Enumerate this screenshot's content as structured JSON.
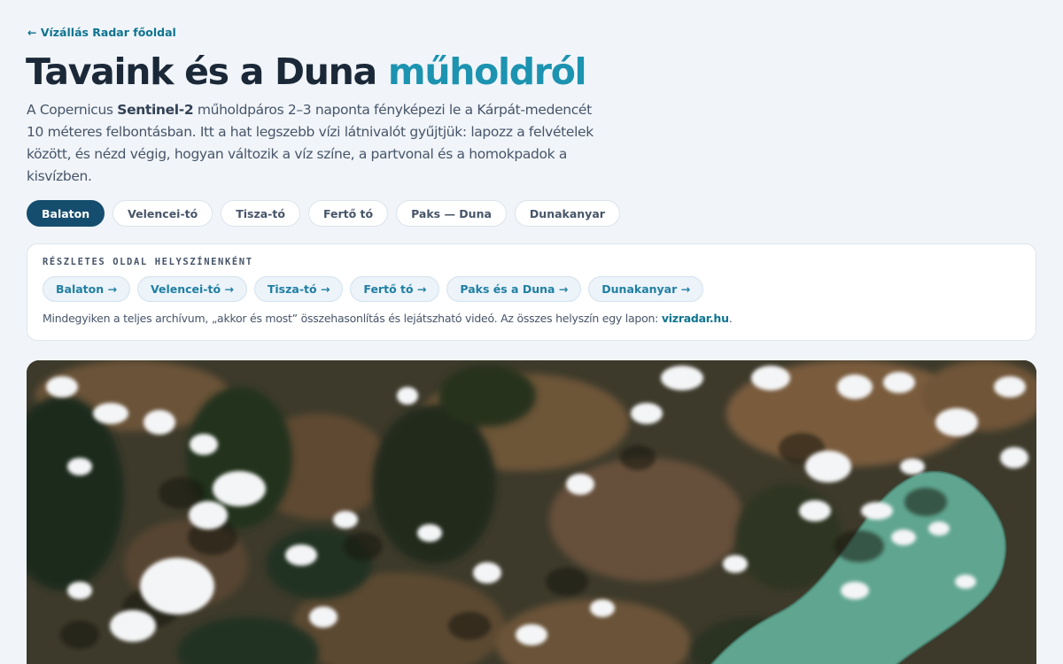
{
  "back_link": "← Vízállás Radar főoldal",
  "title": {
    "main": "Tavaink és a Duna ",
    "accent": "műholdról"
  },
  "intro": {
    "part1": "A Copernicus ",
    "bold": "Sentinel-2",
    "part2": " műholdpáros 2–3 naponta fényképezi le a Kárpát-medencét 10 méteres felbontásban. Itt a hat legszebb vízi látnivalót gyűjtjük: lapozz a felvételek között, és nézd végig, hogyan változik a víz színe, a partvonal és a homokpadok a kisvízben."
  },
  "tabs": [
    {
      "label": "Balaton",
      "active": true
    },
    {
      "label": "Velencei-tó",
      "active": false
    },
    {
      "label": "Tisza-tó",
      "active": false
    },
    {
      "label": "Fertő tó",
      "active": false
    },
    {
      "label": "Paks — Duna",
      "active": false
    },
    {
      "label": "Dunakanyar",
      "active": false
    }
  ],
  "locations_card": {
    "heading": "Részletes oldal helyszínenként",
    "links": [
      "Balaton →",
      "Velencei-tó →",
      "Tisza-tó →",
      "Fertő tó →",
      "Paks és a Duna →",
      "Dunakanyar →"
    ],
    "note_text": "Mindegyiken a teljes archívum, „akkor és most” összehasonlítás és lejátszható videó. Az összes helyszín egy lapon: ",
    "note_link": "vizradar.hu",
    "note_end": "."
  },
  "colors": {
    "accent": "#1c93b0",
    "active_tab": "#154d6e",
    "link": "#0e7490",
    "lake_water": "#5fa58f"
  }
}
